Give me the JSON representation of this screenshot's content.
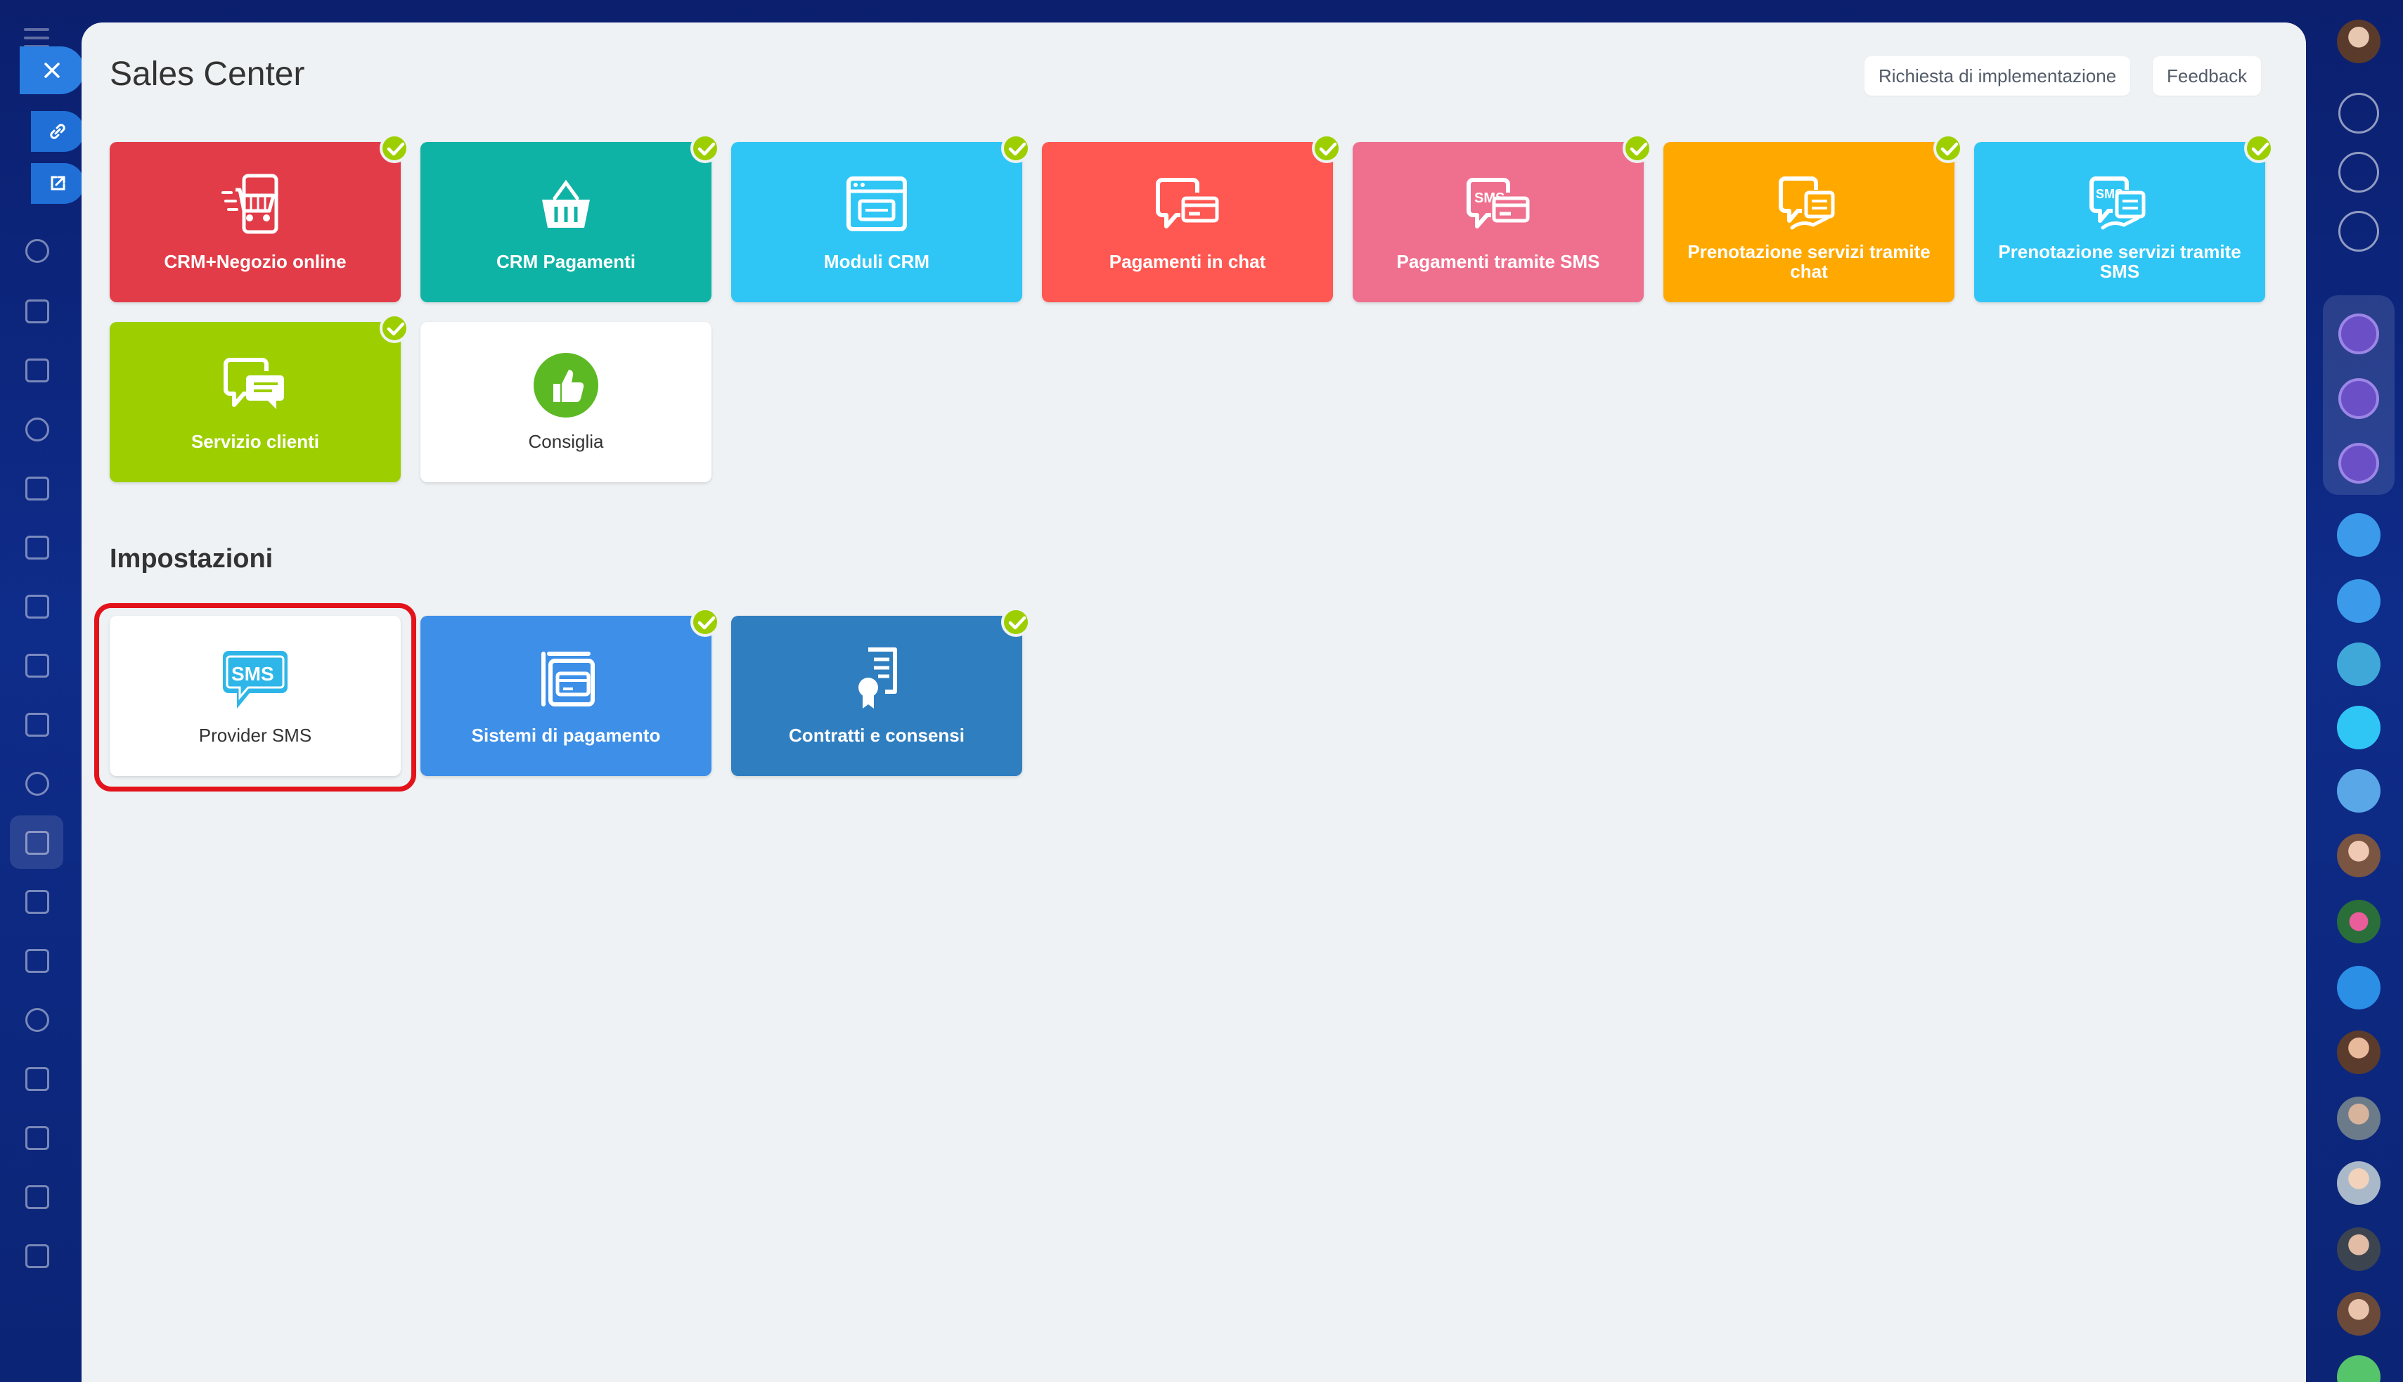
{
  "header": {
    "title": "Sales Center",
    "implementation_request_label": "Richiesta di implementazione",
    "feedback_label": "Feedback"
  },
  "colors": {
    "check_green": "#9dcf00",
    "highlight_red": "#e3131b",
    "panel_bg": "#eef2f4"
  },
  "tiles": [
    {
      "label": "CRM+Negozio online",
      "color": "#e23c48",
      "icon": "online-store-cart-icon",
      "checked": true
    },
    {
      "label": "CRM Pagamenti",
      "color": "#0fb3a5",
      "icon": "shopping-basket-icon",
      "checked": true
    },
    {
      "label": "Moduli CRM",
      "color": "#2fc6f6",
      "icon": "web-form-icon",
      "checked": true
    },
    {
      "label": "Pagamenti in chat",
      "color": "#ff5752",
      "icon": "chat-payment-icon",
      "checked": true
    },
    {
      "label": "Pagamenti tramite SMS",
      "color": "#ef6f8f",
      "icon": "sms-payment-icon",
      "checked": true
    },
    {
      "label": "Prenotazione servizi tramite chat",
      "color": "#ffa900",
      "icon": "chat-booking-icon",
      "checked": true
    },
    {
      "label": "Prenotazione servizi tramite SMS",
      "color": "#2fc6f6",
      "icon": "sms-booking-icon",
      "checked": true
    },
    {
      "label": "Servizio clienti",
      "color": "#9dcf00",
      "icon": "customer-service-chat-icon",
      "checked": true
    },
    {
      "label": "Consiglia",
      "color": "#ffffff",
      "icon": "thumbs-up-icon",
      "checked": false
    }
  ],
  "settings": {
    "title": "Impostazioni",
    "tiles": [
      {
        "label": "Provider SMS",
        "color": "#ffffff",
        "icon": "sms-bubble-icon",
        "checked": false,
        "highlighted": true
      },
      {
        "label": "Sistemi di pagamento",
        "color": "#3d8fe8",
        "icon": "payment-systems-icon",
        "checked": true
      },
      {
        "label": "Contratti e consensi",
        "color": "#2f7ec0",
        "icon": "contract-certificate-icon",
        "checked": true
      }
    ]
  }
}
